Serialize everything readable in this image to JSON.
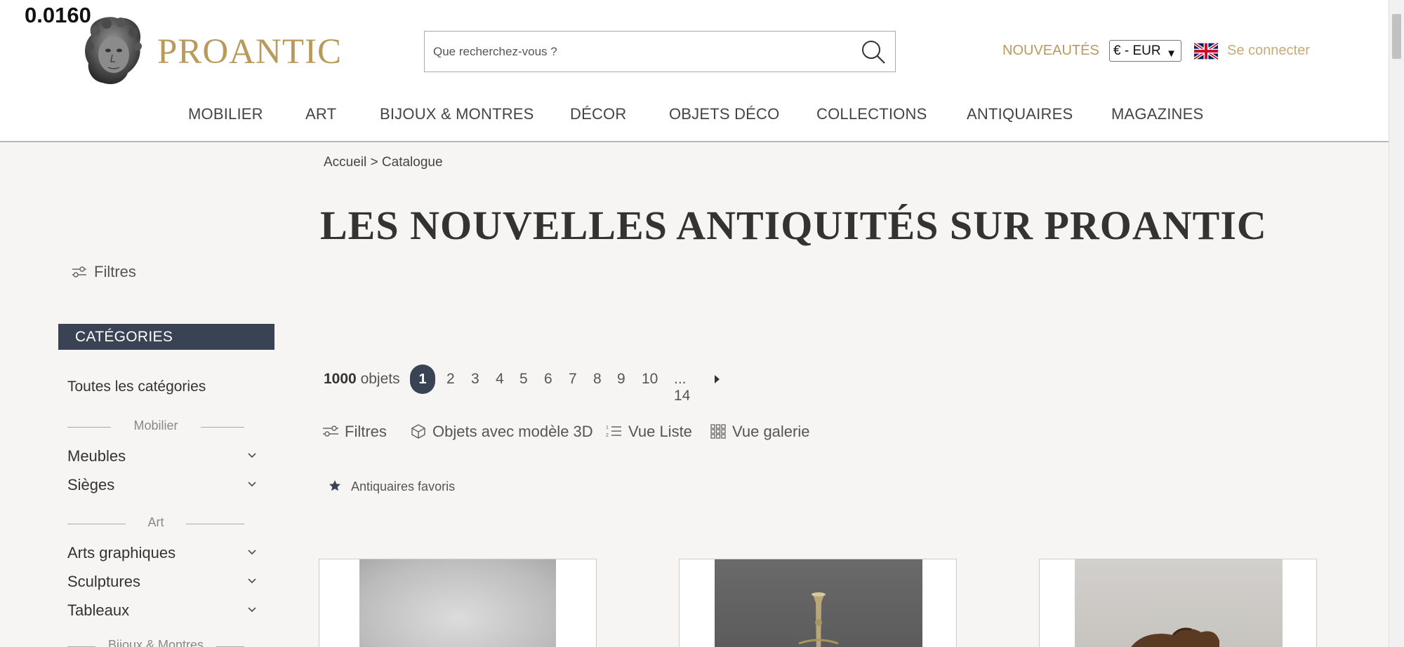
{
  "debug": {
    "value": "0.0160"
  },
  "header": {
    "logo_text": "PROANTIC",
    "search_placeholder": "Que recherchez-vous ?",
    "nouveautes": "NOUVEAUTÉS",
    "currency": "€ - EUR",
    "login": "Se connecter"
  },
  "nav": {
    "items": [
      "MOBILIER",
      "ART",
      "BIJOUX & MONTRES",
      "DÉCOR",
      "OBJETS DÉCO",
      "COLLECTIONS",
      "ANTIQUAIRES",
      "MAGAZINES"
    ]
  },
  "breadcrumb": {
    "home": "Accueil",
    "sep": ">",
    "current": "Catalogue"
  },
  "page": {
    "title": "LES NOUVELLES ANTIQUITÉS SUR PROANTIC"
  },
  "sidebar": {
    "filters_label": "Filtres",
    "categories_header": "CATÉGORIES",
    "all_categories": "Toutes les catégories",
    "groups": [
      {
        "title": "Mobilier",
        "items": [
          "Meubles",
          "Sièges"
        ]
      },
      {
        "title": "Art",
        "items": [
          "Arts graphiques",
          "Sculptures",
          "Tableaux"
        ]
      },
      {
        "title": "Bijoux & Montres",
        "items": []
      }
    ]
  },
  "results": {
    "count": "1000",
    "count_label": "objets",
    "pages": [
      "1",
      "2",
      "3",
      "4",
      "5",
      "6",
      "7",
      "8",
      "9",
      "10"
    ],
    "last_page": "... 14",
    "current_page": "1"
  },
  "toolbar": {
    "filters": "Filtres",
    "objects_3d": "Objets avec modèle 3D",
    "list_view": "Vue Liste",
    "gallery_view": "Vue galerie",
    "favorites": "Antiquaires favoris"
  },
  "colors": {
    "brand_gold": "#b99a5c",
    "dark_slate": "#3a4353",
    "page_bg": "#f6f5f3"
  }
}
